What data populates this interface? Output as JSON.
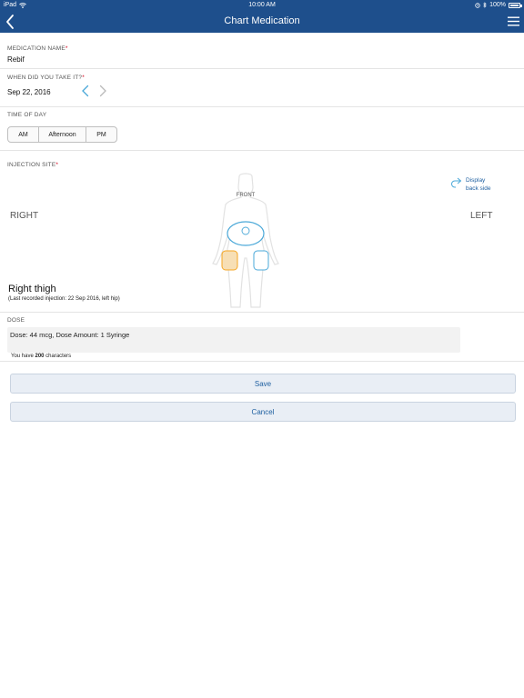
{
  "status_bar": {
    "device": "iPad",
    "time": "10:00 AM",
    "battery": "100%"
  },
  "nav": {
    "title": "Chart Medication"
  },
  "medication": {
    "label": "MEDICATION NAME",
    "required": "*",
    "value": "Rebif"
  },
  "when": {
    "label": "WHEN DID YOU TAKE IT?",
    "required": "*",
    "value": "Sep 22, 2016"
  },
  "time_of_day": {
    "label": "TIME OF DAY",
    "options": [
      "AM",
      "Afternoon",
      "PM"
    ]
  },
  "injection_site": {
    "label": "INJECTION SITE",
    "required": "*",
    "right_label": "RIGHT",
    "left_label": "LEFT",
    "display_back_line1": "Display",
    "display_back_line2": "back side",
    "front_label": "FRONT",
    "selected_site": "Right thigh",
    "last_recorded": "(Last recorded injection: 22 Sep 2016, left hip)"
  },
  "dose": {
    "label": "DOSE",
    "value": "Dose: 44 mcg,  Dose Amount: 1 Syringe",
    "chars_prefix": "You have",
    "chars_count": "200",
    "chars_suffix": "characters"
  },
  "buttons": {
    "save": "Save",
    "cancel": "Cancel"
  },
  "colors": {
    "nav_bg": "#1e4f8c",
    "accent": "#1e5fa0",
    "required": "#d0021b",
    "selected_site": "#f5a623",
    "available_site": "#4aa8d8"
  }
}
